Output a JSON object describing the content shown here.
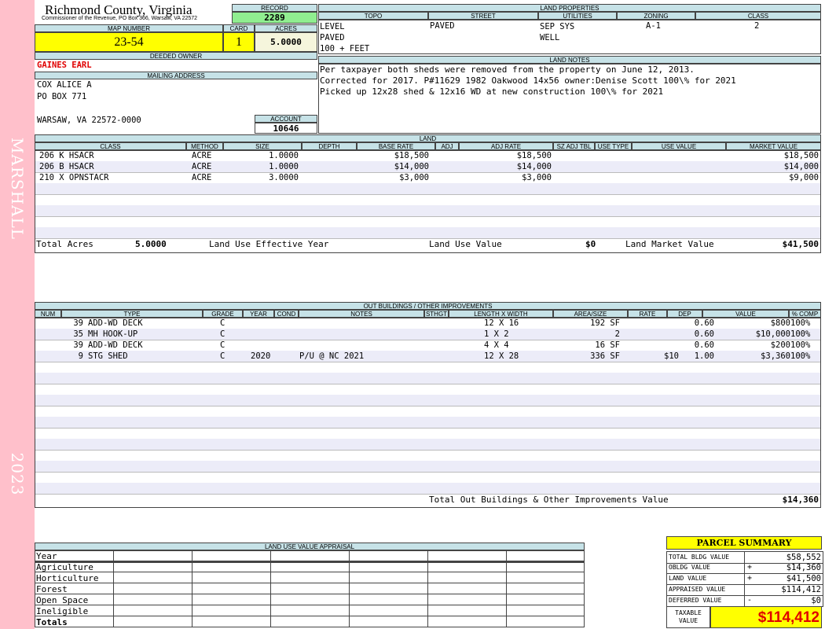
{
  "sidebar": {
    "name": "MARSHALL",
    "year": "2023"
  },
  "header": {
    "county": "Richmond County, Virginia",
    "commissioner": "Commissioner of the Revenue, PO Box 366, Warsaw, VA 22572",
    "record_label": "RECORD",
    "record_value": "2289",
    "map_number_label": "MAP NUMBER",
    "map_number": "23-54",
    "card_label": "CARD",
    "card": "1",
    "acres_label": "ACRES",
    "acres": "5.0000"
  },
  "land_properties": {
    "title": "LAND PROPERTIES",
    "cols": [
      "TOPO",
      "STREET",
      "UTILITIES",
      "ZONING",
      "CLASS"
    ],
    "topo": [
      "LEVEL",
      "PAVED",
      "100 + FEET"
    ],
    "street": "PAVED",
    "utilities": [
      "SEP SYS",
      "WELL"
    ],
    "zoning": "A-1",
    "class": "2"
  },
  "owner": {
    "deeded_label": "DEEDED OWNER",
    "deeded_owner": "GAINES EARL",
    "mailing_label": "MAILING ADDRESS",
    "line1": "COX ALICE A",
    "line2": "PO BOX 771",
    "line3": "WARSAW, VA 22572-0000",
    "account_label": "ACCOUNT",
    "account": "10646"
  },
  "land_notes": {
    "title": "LAND NOTES",
    "lines": [
      "Per taxpayer both sheds were removed from the property on June 12, 2013.",
      "Corrected for 2017. P#11629 1982 Oakwood 14x56 owner:Denise Scott 100\\% for 2021",
      "Picked up 12x28 shed & 12x16 WD at new construction 100\\% for 2021"
    ]
  },
  "land": {
    "title": "LAND",
    "cols": [
      "CLASS",
      "METHOD",
      "SIZE",
      "DEPTH",
      "BASE RATE",
      "ADJ",
      "ADJ RATE",
      "SZ ADJ TBL",
      "USE TYPE",
      "USE VALUE",
      "MARKET VALUE"
    ],
    "rows": [
      {
        "class": "206 K HSACR",
        "method": "ACRE",
        "size": "1.0000",
        "base_rate": "$18,500",
        "adj_rate": "$18,500",
        "market_value": "$18,500"
      },
      {
        "class": "206 B HSACR",
        "method": "ACRE",
        "size": "1.0000",
        "base_rate": "$14,000",
        "adj_rate": "$14,000",
        "market_value": "$14,000"
      },
      {
        "class": "210 X OPNSTACR",
        "method": "ACRE",
        "size": "3.0000",
        "base_rate": "$3,000",
        "adj_rate": "$3,000",
        "market_value": "$9,000"
      }
    ],
    "total_acres_label": "Total Acres",
    "total_acres": "5.0000",
    "effective_year_label": "Land Use Effective Year",
    "use_value_label": "Land Use Value",
    "use_value": "$0",
    "market_value_label": "Land Market Value",
    "market_value": "$41,500"
  },
  "outbuildings": {
    "title": "OUT BUILDINGS / OTHER IMPROVEMENTS",
    "cols": [
      "NUM",
      "TYPE",
      "GRADE",
      "YEAR",
      "COND",
      "NOTES",
      "STHGT",
      "LENGTH X WIDTH",
      "AREA/SIZE",
      "RATE",
      "DEP",
      "VALUE",
      "% COMP"
    ],
    "rows": [
      {
        "type": "39 ADD-WD DECK",
        "grade": "C",
        "year": "",
        "notes": "",
        "lxw": "12 X 16",
        "area": "192 SF",
        "rate": "",
        "dep": "0.60",
        "value": "$800",
        "comp": "100%"
      },
      {
        "type": "35 MH HOOK-UP",
        "grade": "C",
        "year": "",
        "notes": "",
        "lxw": "1 X 2",
        "area": "2",
        "rate": "",
        "dep": "0.60",
        "value": "$10,000",
        "comp": "100%"
      },
      {
        "type": "39 ADD-WD DECK",
        "grade": "C",
        "year": "",
        "notes": "",
        "lxw": "4 X 4",
        "area": "16 SF",
        "rate": "",
        "dep": "0.60",
        "value": "$200",
        "comp": "100%"
      },
      {
        "type": "9 STG SHED",
        "grade": "C",
        "year": "2020",
        "notes": "P/U @ NC 2021",
        "lxw": "12 X 28",
        "area": "336 SF",
        "rate": "$10",
        "dep": "1.00",
        "value": "$3,360",
        "comp": "100%"
      }
    ],
    "total_label": "Total Out Buildings & Other Improvements Value",
    "total": "$14,360"
  },
  "land_use": {
    "title": "LAND USE VALUE APPRAISAL",
    "rows": [
      "Year",
      "Agriculture",
      "Horticulture",
      "Forest",
      "Open Space",
      "Ineligible",
      "Totals"
    ]
  },
  "summary": {
    "title": "PARCEL SUMMARY",
    "rows": [
      {
        "label": "TOTAL BLDG VALUE",
        "op": "",
        "value": "$58,552"
      },
      {
        "label": "OBLDG VALUE",
        "op": "+",
        "value": "$14,360"
      },
      {
        "label": "LAND VALUE",
        "op": "+",
        "value": "$41,500"
      },
      {
        "label": "APPRAISED VALUE",
        "op": "",
        "value": "$114,412"
      },
      {
        "label": "DEFERRED VALUE",
        "op": "-",
        "value": "$0"
      }
    ],
    "taxable_label_1": "TAXABLE",
    "taxable_label_2": "VALUE",
    "taxable_value": "$114,412"
  }
}
